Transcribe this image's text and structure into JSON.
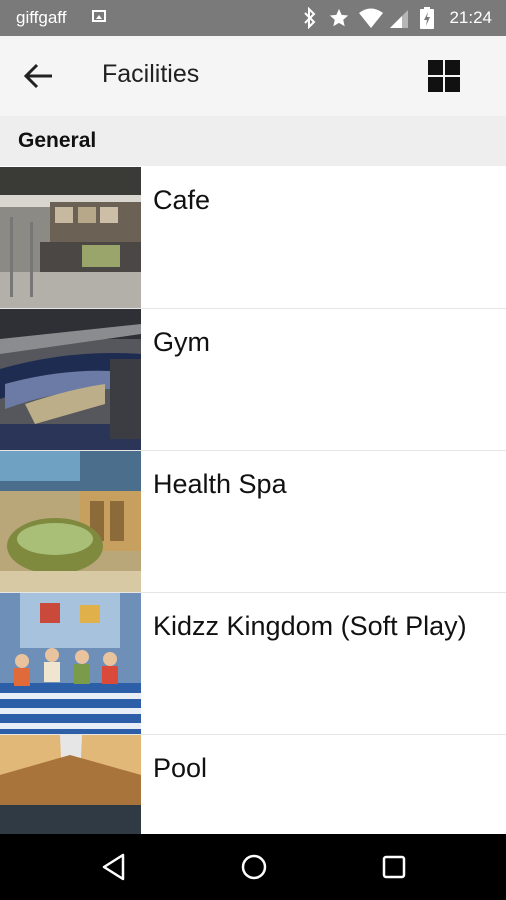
{
  "status_bar": {
    "carrier": "giffgaff",
    "time": "21:24",
    "icons": [
      "image-notification-icon",
      "bluetooth-icon",
      "star-icon",
      "wifi-icon",
      "signal-icon",
      "battery-charging-icon"
    ]
  },
  "toolbar": {
    "title": "Facilities",
    "back_icon": "arrow-back-icon",
    "view_toggle_icon": "grid-view-icon"
  },
  "section": {
    "title": "General"
  },
  "facilities": [
    {
      "label": "Cafe",
      "image": "cafe-photo"
    },
    {
      "label": "Gym",
      "image": "gym-photo"
    },
    {
      "label": "Health Spa",
      "image": "health-spa-photo"
    },
    {
      "label": "Kidzz Kingdom (Soft Play)",
      "image": "soft-play-photo"
    },
    {
      "label": "Pool",
      "image": "pool-photo"
    }
  ],
  "nav_bar": {
    "icons": [
      "back-triangle-icon",
      "home-circle-icon",
      "recents-square-icon"
    ]
  }
}
